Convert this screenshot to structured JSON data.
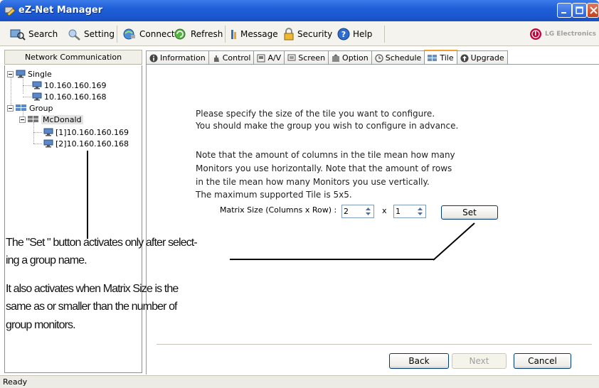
{
  "window": {
    "title": "eZ-Net Manager"
  },
  "toolbar": {
    "search": "Search",
    "setting": "Setting",
    "connect": "Connect",
    "refresh": "Refresh",
    "message": "Message",
    "security": "Security",
    "help": "Help",
    "brand": "LG Electronics"
  },
  "left_panel": {
    "header": "Network Communication",
    "tree": {
      "single": "Single",
      "single_items": [
        "10.160.160.169",
        "10.160.160.168"
      ],
      "group": "Group",
      "group_name": "McDonald",
      "group_items": [
        "[1]10.160.160.169",
        "[2]10.160.160.168"
      ]
    }
  },
  "tabs": [
    "Information",
    "Control",
    "A/V",
    "Screen",
    "Option",
    "Schedule",
    "Tile",
    "Upgrade"
  ],
  "active_tab": "Tile",
  "content": {
    "line1": "Please specify the size of the tile you want to configure.",
    "line2": "You should make the group you wish to configure in advance.",
    "line3": "Note that the amount of columns in the tile mean how many",
    "line4": "Monitors you use horizontally. Note that the amount of rows",
    "line5": "in the tile mean how many Monitors you use vertically.",
    "line6": "The maximum supported Tile is 5x5.",
    "matrix_label": "Matrix Size (Columns x Row) :",
    "columns_value": "2",
    "times": "x",
    "rows_value": "1",
    "set_button": "Set"
  },
  "footer": {
    "back": "Back",
    "next": "Next",
    "cancel": "Cancel"
  },
  "status": {
    "text": "Ready"
  },
  "annotation": {
    "line1": "The  \"Set \" button activates only after select-",
    "line2": "ing a group name.",
    "line3": "It also activates when Matrix Size is the",
    "line4": "same as or smaller than the number of",
    "line5": "group monitors."
  },
  "colors": {
    "titlebar": "#1f5fd8",
    "tab_accent": "#f0a030",
    "lg_red": "#c5003e"
  }
}
